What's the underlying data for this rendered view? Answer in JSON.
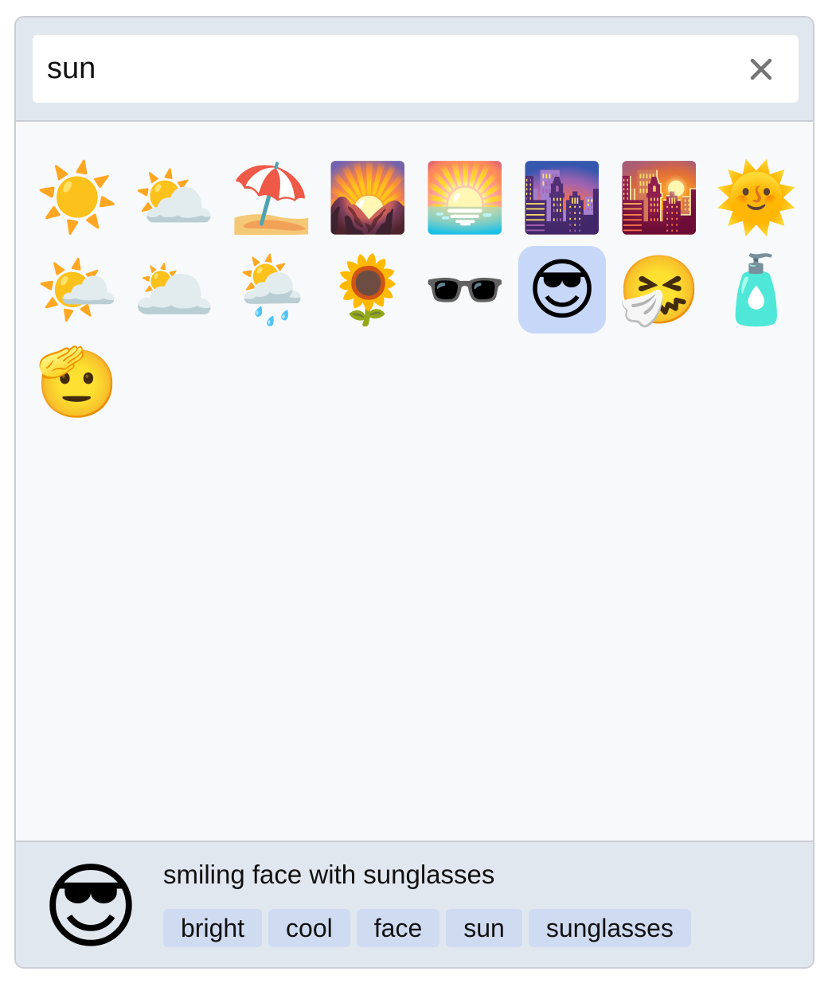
{
  "search": {
    "value": "sun",
    "placeholder": "",
    "clear_icon": "close-icon"
  },
  "results": [
    {
      "emoji": "☀️",
      "name": "sun"
    },
    {
      "emoji": "⛅",
      "name": "sun behind cloud"
    },
    {
      "emoji": "⛱️",
      "name": "umbrella on ground"
    },
    {
      "emoji": "🌄",
      "name": "sunrise over mountains"
    },
    {
      "emoji": "🌅",
      "name": "sunrise"
    },
    {
      "emoji": "🌆",
      "name": "cityscape at dusk"
    },
    {
      "emoji": "🌇",
      "name": "sunset"
    },
    {
      "emoji": "🌞",
      "name": "sun with face"
    },
    {
      "emoji": "🌤️",
      "name": "sun behind small cloud"
    },
    {
      "emoji": "🌥️",
      "name": "sun behind large cloud"
    },
    {
      "emoji": "🌦️",
      "name": "sun behind rain cloud"
    },
    {
      "emoji": "🌻",
      "name": "sunflower"
    },
    {
      "emoji": "🕶️",
      "name": "sunglasses"
    },
    {
      "emoji": "😎",
      "name": "smiling face with sunglasses",
      "selected": true
    },
    {
      "emoji": "🤧",
      "name": "sneezing face"
    },
    {
      "emoji": "🧴",
      "name": "lotion bottle"
    },
    {
      "emoji": "🫡",
      "name": "saluting face"
    }
  ],
  "preview": {
    "emoji": "😎",
    "name": "smiling face with sunglasses",
    "tags": [
      "bright",
      "cool",
      "face",
      "sun",
      "sunglasses"
    ]
  },
  "colors": {
    "selected_background": "#c7d7f8",
    "tag_background": "#cfdbf1",
    "panel_background": "#e1e7ef"
  }
}
